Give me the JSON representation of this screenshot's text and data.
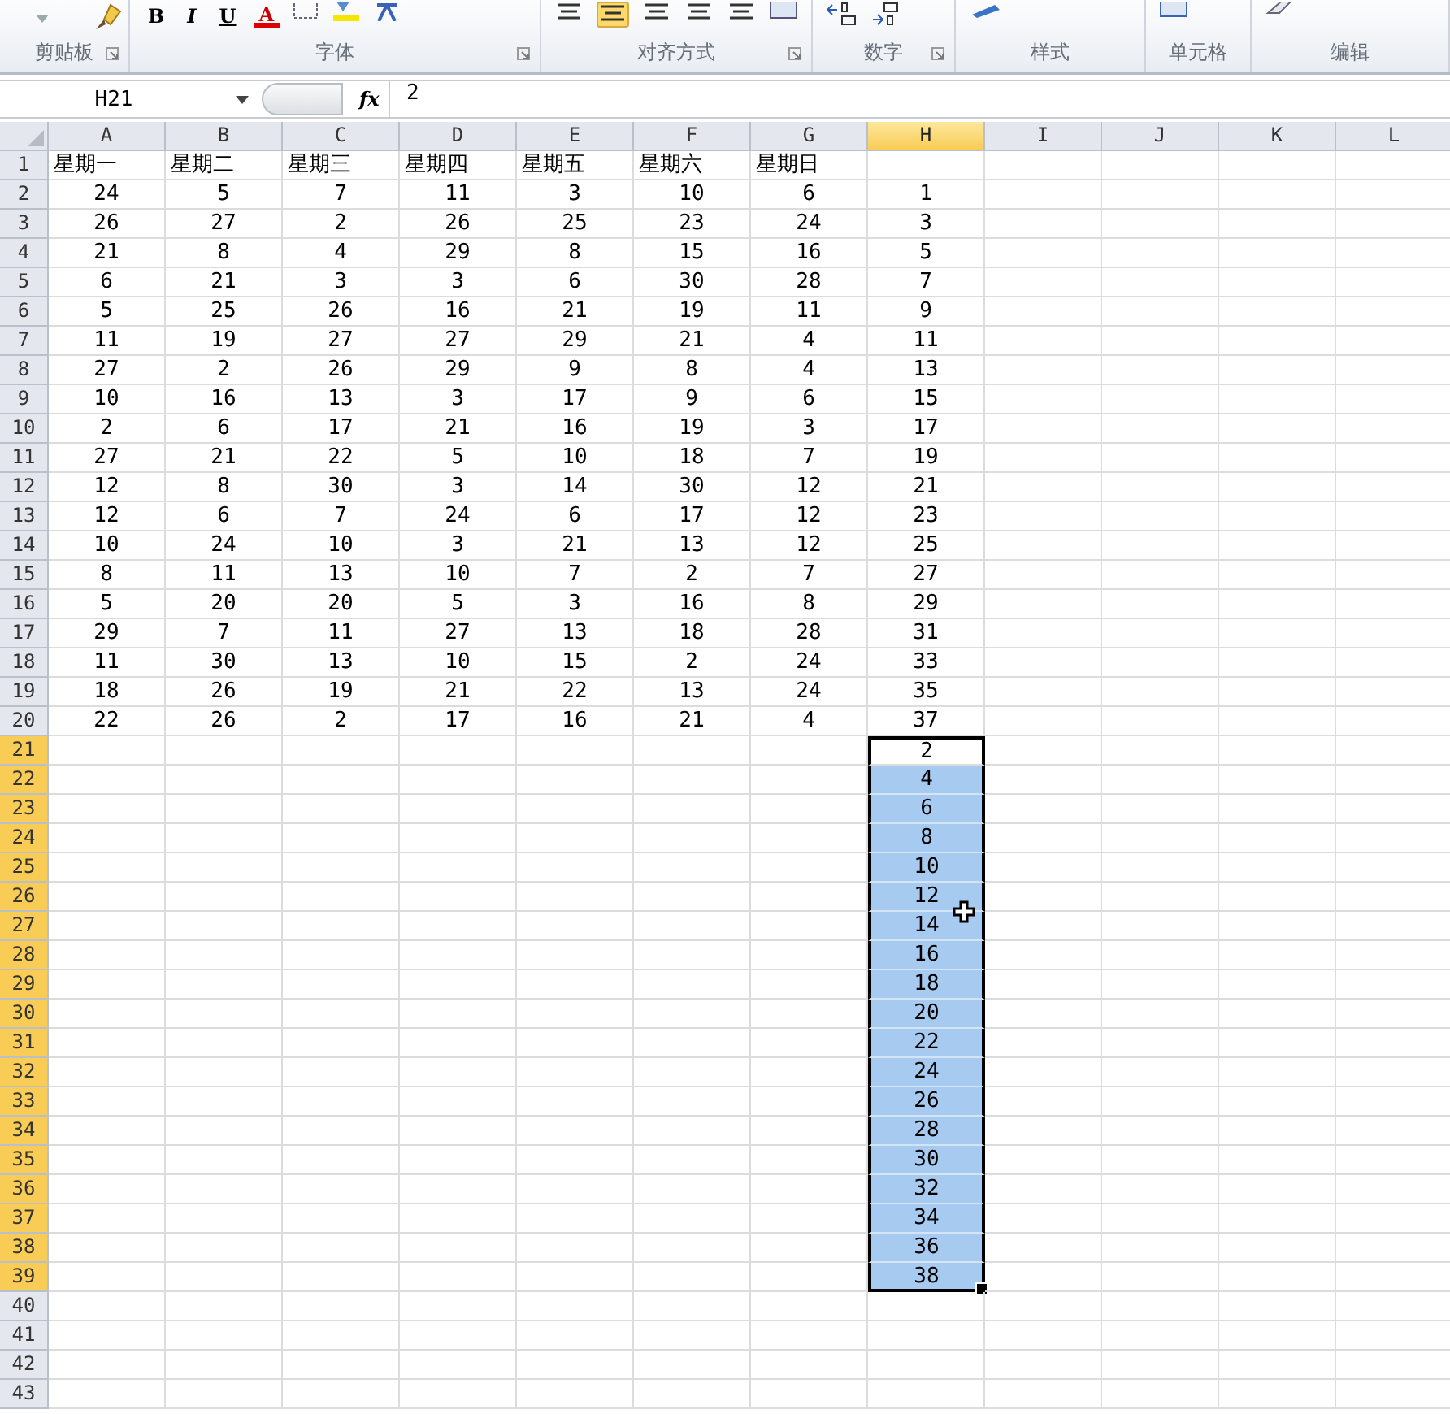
{
  "ribbon": {
    "groups": [
      {
        "label": "剪贴板",
        "launcher": true,
        "kind": "clipboard"
      },
      {
        "label": "字体",
        "launcher": true,
        "kind": "font",
        "buttons": [
          "B",
          "I",
          "U",
          "A"
        ]
      },
      {
        "label": "对齐方式",
        "launcher": true,
        "kind": "align"
      },
      {
        "label": "数字",
        "launcher": true,
        "kind": "number"
      },
      {
        "label": "样式",
        "launcher": false,
        "kind": "styles"
      },
      {
        "label": "单元格",
        "launcher": false,
        "kind": "cells"
      },
      {
        "label": "编辑",
        "launcher": false,
        "kind": "edit"
      }
    ]
  },
  "formula_bar": {
    "name_box": "H21",
    "fx": "fx",
    "value": "2"
  },
  "columns": [
    {
      "label": "A",
      "selected": false
    },
    {
      "label": "B",
      "selected": false
    },
    {
      "label": "C",
      "selected": false
    },
    {
      "label": "D",
      "selected": false
    },
    {
      "label": "E",
      "selected": false
    },
    {
      "label": "F",
      "selected": false
    },
    {
      "label": "G",
      "selected": false
    },
    {
      "label": "H",
      "selected": true
    },
    {
      "label": "I",
      "selected": false
    },
    {
      "label": "J",
      "selected": false
    },
    {
      "label": "K",
      "selected": false
    },
    {
      "label": "L",
      "selected": false
    }
  ],
  "rows": [
    {
      "number": "1",
      "selected": false,
      "kind": "header",
      "cells": [
        "星期一",
        "星期二",
        "星期三",
        "星期四",
        "星期五",
        "星期六",
        "星期日"
      ]
    },
    {
      "number": "2",
      "selected": false,
      "cells": [
        "24",
        "5",
        "7",
        "11",
        "3",
        "10",
        "6",
        "1"
      ]
    },
    {
      "number": "3",
      "selected": false,
      "cells": [
        "26",
        "27",
        "2",
        "26",
        "25",
        "23",
        "24",
        "3"
      ]
    },
    {
      "number": "4",
      "selected": false,
      "cells": [
        "21",
        "8",
        "4",
        "29",
        "8",
        "15",
        "16",
        "5"
      ]
    },
    {
      "number": "5",
      "selected": false,
      "cells": [
        "6",
        "21",
        "3",
        "3",
        "6",
        "30",
        "28",
        "7"
      ]
    },
    {
      "number": "6",
      "selected": false,
      "cells": [
        "5",
        "25",
        "26",
        "16",
        "21",
        "19",
        "11",
        "9"
      ]
    },
    {
      "number": "7",
      "selected": false,
      "cells": [
        "11",
        "19",
        "27",
        "27",
        "29",
        "21",
        "4",
        "11"
      ]
    },
    {
      "number": "8",
      "selected": false,
      "cells": [
        "27",
        "2",
        "26",
        "29",
        "9",
        "8",
        "4",
        "13"
      ]
    },
    {
      "number": "9",
      "selected": false,
      "cells": [
        "10",
        "16",
        "13",
        "3",
        "17",
        "9",
        "6",
        "15"
      ]
    },
    {
      "number": "10",
      "selected": false,
      "cells": [
        "2",
        "6",
        "17",
        "21",
        "16",
        "19",
        "3",
        "17"
      ]
    },
    {
      "number": "11",
      "selected": false,
      "cells": [
        "27",
        "21",
        "22",
        "5",
        "10",
        "18",
        "7",
        "19"
      ]
    },
    {
      "number": "12",
      "selected": false,
      "cells": [
        "12",
        "8",
        "30",
        "3",
        "14",
        "30",
        "12",
        "21"
      ]
    },
    {
      "number": "13",
      "selected": false,
      "cells": [
        "12",
        "6",
        "7",
        "24",
        "6",
        "17",
        "12",
        "23"
      ]
    },
    {
      "number": "14",
      "selected": false,
      "cells": [
        "10",
        "24",
        "10",
        "3",
        "21",
        "13",
        "12",
        "25"
      ]
    },
    {
      "number": "15",
      "selected": false,
      "cells": [
        "8",
        "11",
        "13",
        "10",
        "7",
        "2",
        "7",
        "27"
      ]
    },
    {
      "number": "16",
      "selected": false,
      "cells": [
        "5",
        "20",
        "20",
        "5",
        "3",
        "16",
        "8",
        "29"
      ]
    },
    {
      "number": "17",
      "selected": false,
      "cells": [
        "29",
        "7",
        "11",
        "27",
        "13",
        "18",
        "28",
        "31"
      ]
    },
    {
      "number": "18",
      "selected": false,
      "cells": [
        "11",
        "30",
        "13",
        "10",
        "15",
        "2",
        "24",
        "33"
      ]
    },
    {
      "number": "19",
      "selected": false,
      "cells": [
        "18",
        "26",
        "19",
        "21",
        "22",
        "13",
        "24",
        "35"
      ]
    },
    {
      "number": "20",
      "selected": false,
      "cells": [
        "22",
        "26",
        "2",
        "17",
        "16",
        "21",
        "4",
        "37"
      ]
    },
    {
      "number": "21",
      "selected": true,
      "active": true,
      "column_h": "2"
    },
    {
      "number": "22",
      "selected": true,
      "active": false,
      "column_h": "4"
    },
    {
      "number": "23",
      "selected": true,
      "active": false,
      "column_h": "6"
    },
    {
      "number": "24",
      "selected": true,
      "active": false,
      "column_h": "8"
    },
    {
      "number": "25",
      "selected": true,
      "active": false,
      "column_h": "10"
    },
    {
      "number": "26",
      "selected": true,
      "active": false,
      "column_h": "12",
      "cursor": true
    },
    {
      "number": "27",
      "selected": true,
      "active": false,
      "column_h": "14"
    },
    {
      "number": "28",
      "selected": true,
      "active": false,
      "column_h": "16"
    },
    {
      "number": "29",
      "selected": true,
      "active": false,
      "column_h": "18"
    },
    {
      "number": "30",
      "selected": true,
      "active": false,
      "column_h": "20"
    },
    {
      "number": "31",
      "selected": true,
      "active": false,
      "column_h": "22"
    },
    {
      "number": "32",
      "selected": true,
      "active": false,
      "column_h": "24"
    },
    {
      "number": "33",
      "selected": true,
      "active": false,
      "column_h": "26"
    },
    {
      "number": "34",
      "selected": true,
      "active": false,
      "column_h": "28"
    },
    {
      "number": "35",
      "selected": true,
      "active": false,
      "column_h": "30"
    },
    {
      "number": "36",
      "selected": true,
      "active": false,
      "column_h": "32"
    },
    {
      "number": "37",
      "selected": true,
      "active": false,
      "column_h": "34"
    },
    {
      "number": "38",
      "selected": true,
      "active": false,
      "column_h": "36"
    },
    {
      "number": "39",
      "selected": true,
      "active": false,
      "column_h": "38"
    },
    {
      "number": "40",
      "selected": false
    },
    {
      "number": "41",
      "selected": false
    },
    {
      "number": "42",
      "selected": false
    },
    {
      "number": "43",
      "selected": false
    }
  ]
}
